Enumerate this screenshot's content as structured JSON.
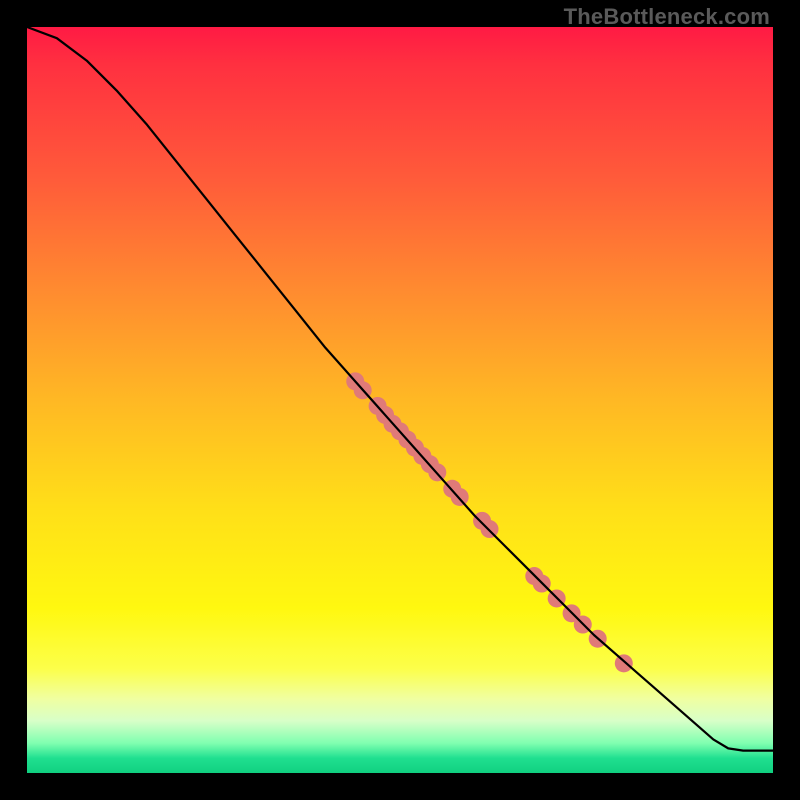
{
  "watermark": "TheBottleneck.com",
  "chart_data": {
    "type": "line",
    "title": "",
    "xlabel": "",
    "ylabel": "",
    "xlim": [
      0,
      100
    ],
    "ylim": [
      0,
      100
    ],
    "grid": false,
    "legend": false,
    "series": [
      {
        "name": "curve",
        "color": "#000000",
        "x": [
          0,
          4,
          8,
          12,
          16,
          20,
          24,
          28,
          32,
          36,
          40,
          44,
          48,
          52,
          56,
          60,
          64,
          68,
          72,
          76,
          80,
          84,
          88,
          92,
          94,
          96,
          100
        ],
        "y": [
          100,
          98.5,
          95.5,
          91.5,
          87,
          82,
          77,
          72,
          67,
          62,
          57,
          52.5,
          48,
          43.5,
          39,
          34.5,
          30.5,
          26.5,
          22.5,
          18.5,
          15,
          11.5,
          8,
          4.5,
          3.3,
          3.0,
          3.0
        ]
      }
    ],
    "scatter_points": {
      "color": "#e07a78",
      "radius_px": 9,
      "points_xy": [
        [
          44,
          52.5
        ],
        [
          45,
          51.3
        ],
        [
          47,
          49.2
        ],
        [
          48,
          48.0
        ],
        [
          49,
          46.8
        ],
        [
          50,
          45.8
        ],
        [
          51,
          44.7
        ],
        [
          52,
          43.6
        ],
        [
          53,
          42.5
        ],
        [
          54,
          41.4
        ],
        [
          55,
          40.3
        ],
        [
          57,
          38.1
        ],
        [
          58,
          37.0
        ],
        [
          61,
          33.8
        ],
        [
          62,
          32.7
        ],
        [
          68,
          26.4
        ],
        [
          69,
          25.4
        ],
        [
          71,
          23.4
        ],
        [
          73,
          21.4
        ],
        [
          74.5,
          19.9
        ],
        [
          76.5,
          18.0
        ],
        [
          80,
          14.7
        ]
      ]
    },
    "colors": {
      "top": "#ff1a44",
      "middle": "#ffe018",
      "bottom": "#10d080",
      "curve": "#000000",
      "points": "#e07a78"
    }
  }
}
